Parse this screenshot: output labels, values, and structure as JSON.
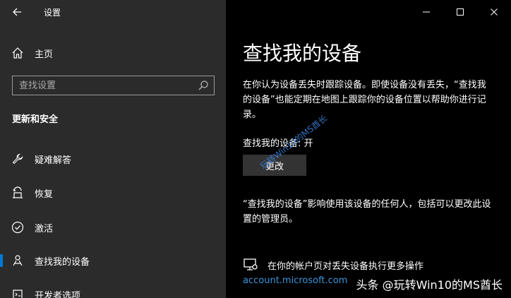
{
  "app": {
    "title": "设置"
  },
  "sidebar": {
    "home_label": "主页",
    "search_placeholder": "查找设置",
    "section_header": "更新和安全",
    "items": [
      {
        "label": "疑难解答",
        "icon": "wrench-icon"
      },
      {
        "label": "恢复",
        "icon": "recovery-icon"
      },
      {
        "label": "激活",
        "icon": "check-circle-icon"
      },
      {
        "label": "查找我的设备",
        "icon": "person-location-icon",
        "active": true
      },
      {
        "label": "开发者选项",
        "icon": "developer-icon"
      }
    ]
  },
  "main": {
    "title": "查找我的设备",
    "description": "在你认为设备丢失时跟踪设备。即使设备没有丢失，“查找我的设备”也能定期在地图上跟踪你的设备位置以帮助你进行记录。",
    "status": "查找我的设备: 开",
    "change_button": "更改",
    "description2": "“查找我的设备”影响使用该设备的任何人，包括可以更改此设置的管理员。",
    "more_label": "在你的帐户页对丢失设备执行更多操作",
    "link_text": "account.microsoft.com"
  },
  "overlay": {
    "diagonal_watermark": "玩转Win10的MS酋长",
    "bottom_watermark": "头条 @玩转Win10的MS酋长"
  },
  "colors": {
    "accent": "#0078d7",
    "link": "#3a96dd",
    "sidebar_bg": "#2b2b2b",
    "content_bg": "#000000"
  }
}
